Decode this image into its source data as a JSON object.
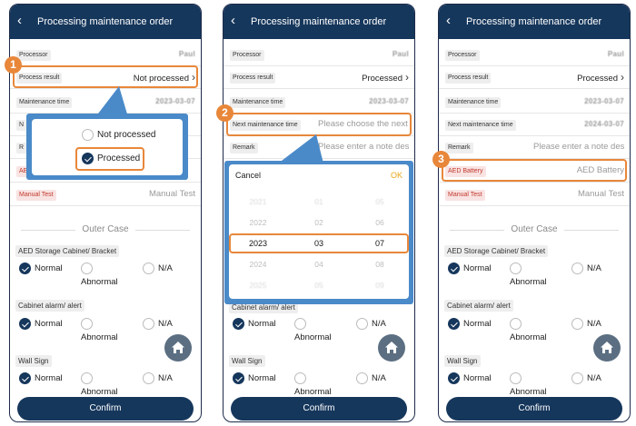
{
  "panels": [
    {
      "title": "Processing maintenance order",
      "badge": "1",
      "rows": {
        "processor_label": "Processor",
        "processor_value": "Paul",
        "process_result_label": "Process result",
        "process_result_value": "Not processed",
        "maintenance_time_label": "Maintenance time",
        "maintenance_time_value": "2023-03-07",
        "next_label_partial": "N",
        "remark_label_partial": "R",
        "aed_label_partial": "AE",
        "manual_test_label": "Manual Test",
        "manual_test_value": "Manual Test"
      },
      "popup": {
        "option_not_processed": "Not processed",
        "option_processed": "Processed"
      }
    },
    {
      "title": "Processing maintenance order",
      "badge": "2",
      "rows": {
        "processor_label": "Processor",
        "processor_value": "Paul",
        "process_result_label": "Process result",
        "process_result_value": "Processed",
        "maintenance_time_label": "Maintenance time",
        "maintenance_time_value": "2023-03-07",
        "next_label": "Next maintenance time",
        "next_value": "Please choose the next u",
        "remark_label": "Remark",
        "remark_value": "Please enter a note desc"
      },
      "picker": {
        "cancel": "Cancel",
        "ok": "OK",
        "years": [
          "2021",
          "2022",
          "2023",
          "2024",
          "2025"
        ],
        "months": [
          "01",
          "02",
          "03",
          "04",
          "05"
        ],
        "days": [
          "05",
          "06",
          "07",
          "08",
          "09"
        ]
      },
      "cabinet_alarm_partial": "Cabinet alarm/ alert"
    },
    {
      "title": "Processing maintenance order",
      "badge": "3",
      "rows": {
        "processor_label": "Processor",
        "processor_value": "Paul",
        "process_result_label": "Process result",
        "process_result_value": "Processed",
        "maintenance_time_label": "Maintenance time",
        "maintenance_time_value": "2023-03-07",
        "next_label": "Next maintenance time",
        "next_value": "2024-03-07",
        "remark_label": "Remark",
        "remark_value": "Please enter a note desc",
        "aed_label": "AED Battery",
        "aed_value": "AED Battery",
        "manual_test_label": "Manual Test",
        "manual_test_value": "Manual Test"
      }
    }
  ],
  "section": "Outer Case",
  "questions": [
    "AED Storage Cabinet/ Bracket",
    "Cabinet alarm/ alert",
    "Wall Sign"
  ],
  "options": {
    "normal": "Normal",
    "abnormal": "Abnormal",
    "na": "N/A"
  },
  "confirm": "Confirm",
  "colors": {
    "nav": "#16375c",
    "highlight": "#e8873a",
    "popup": "#4a8ac9"
  }
}
